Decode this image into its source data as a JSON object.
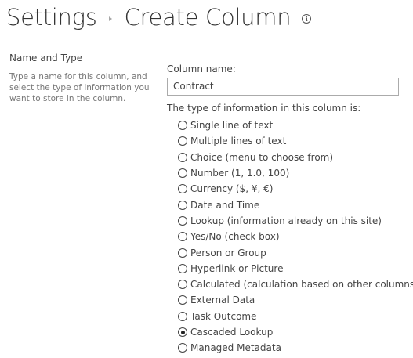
{
  "header": {
    "breadcrumb_root": "Settings",
    "page_title": "Create Column"
  },
  "section": {
    "title": "Name and Type",
    "description": "Type a name for this column, and select the type of information you want to store in the column."
  },
  "column_name": {
    "label": "Column name:",
    "value": "Contract"
  },
  "type_prompt": "The type of information in this column is:",
  "types": [
    {
      "label": "Single line of text",
      "checked": false
    },
    {
      "label": "Multiple lines of text",
      "checked": false
    },
    {
      "label": "Choice (menu to choose from)",
      "checked": false
    },
    {
      "label": "Number (1, 1.0, 100)",
      "checked": false
    },
    {
      "label": "Currency ($, ¥, €)",
      "checked": false
    },
    {
      "label": "Date and Time",
      "checked": false
    },
    {
      "label": "Lookup (information already on this site)",
      "checked": false
    },
    {
      "label": "Yes/No (check box)",
      "checked": false
    },
    {
      "label": "Person or Group",
      "checked": false
    },
    {
      "label": "Hyperlink or Picture",
      "checked": false
    },
    {
      "label": "Calculated (calculation based on other columns)",
      "checked": false
    },
    {
      "label": "External Data",
      "checked": false
    },
    {
      "label": "Task Outcome",
      "checked": false
    },
    {
      "label": "Cascaded Lookup",
      "checked": true
    },
    {
      "label": "Managed Metadata",
      "checked": false
    }
  ],
  "icons": {
    "info": "info-icon",
    "separator": "breadcrumb-separator-icon"
  }
}
